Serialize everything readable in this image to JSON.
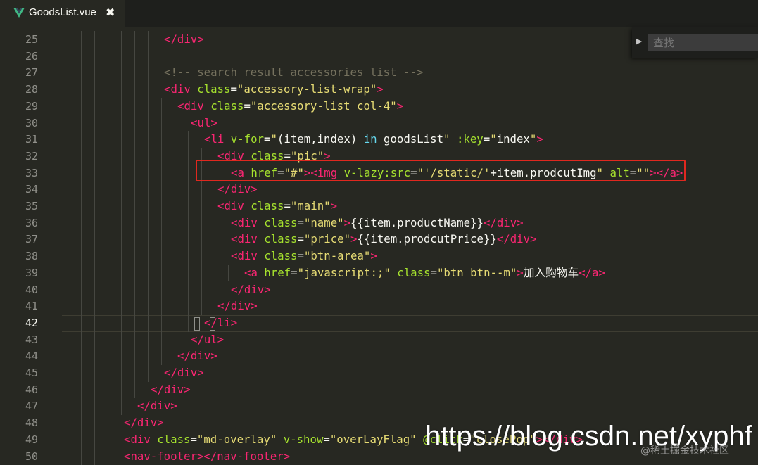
{
  "tab": {
    "title": "GoodsList.vue",
    "close": "✖"
  },
  "find": {
    "placeholder": "查找"
  },
  "current_line": 42,
  "lines": [
    {
      "n": "25",
      "indent": 7,
      "tokens": [
        [
          "tag",
          "</div>"
        ]
      ]
    },
    {
      "n": "26",
      "indent": 0,
      "tokens": []
    },
    {
      "n": "27",
      "indent": 7,
      "tokens": [
        [
          "com",
          "<!-- search result accessories list -->"
        ]
      ]
    },
    {
      "n": "28",
      "indent": 7,
      "tokens": [
        [
          "tag",
          "<div "
        ],
        [
          "attr",
          "class"
        ],
        [
          "pun",
          "="
        ],
        [
          "str",
          "\"accessory-list-wrap\""
        ],
        [
          "tag",
          ">"
        ]
      ]
    },
    {
      "n": "29",
      "indent": 8,
      "tokens": [
        [
          "tag",
          "<div "
        ],
        [
          "attr",
          "class"
        ],
        [
          "pun",
          "="
        ],
        [
          "str",
          "\"accessory-list col-4\""
        ],
        [
          "tag",
          ">"
        ]
      ]
    },
    {
      "n": "30",
      "indent": 9,
      "tokens": [
        [
          "tag",
          "<ul>"
        ]
      ]
    },
    {
      "n": "31",
      "indent": 10,
      "tokens": [
        [
          "tag",
          "<li "
        ],
        [
          "attr",
          "v-for"
        ],
        [
          "pun",
          "="
        ],
        [
          "str",
          "\""
        ],
        [
          "txt",
          "(item,index) "
        ],
        [
          "kw",
          "in"
        ],
        [
          "txt",
          " goodsList"
        ],
        [
          "str",
          "\""
        ],
        [
          "txt",
          " "
        ],
        [
          "attr",
          ":key"
        ],
        [
          "pun",
          "="
        ],
        [
          "str",
          "\""
        ],
        [
          "txt",
          "index"
        ],
        [
          "str",
          "\""
        ],
        [
          "tag",
          ">"
        ]
      ]
    },
    {
      "n": "32",
      "indent": 11,
      "tokens": [
        [
          "tag",
          "<div "
        ],
        [
          "attr",
          "class"
        ],
        [
          "pun",
          "="
        ],
        [
          "str",
          "\"pic\""
        ],
        [
          "tag",
          ">"
        ]
      ]
    },
    {
      "n": "33",
      "indent": 12,
      "tokens": [
        [
          "tag",
          "<a "
        ],
        [
          "attr",
          "href"
        ],
        [
          "pun",
          "="
        ],
        [
          "str",
          "\"#\""
        ],
        [
          "tag",
          ">"
        ],
        [
          "tag",
          "<img "
        ],
        [
          "attr",
          "v-lazy:src"
        ],
        [
          "pun",
          "="
        ],
        [
          "str",
          "\"'/static/'"
        ],
        [
          "txt",
          "+item.prodcutImg"
        ],
        [
          "str",
          "\""
        ],
        [
          "txt",
          " "
        ],
        [
          "attr",
          "alt"
        ],
        [
          "pun",
          "="
        ],
        [
          "str",
          "\"\""
        ],
        [
          "tag",
          ">"
        ],
        [
          "tag",
          "</a>"
        ]
      ]
    },
    {
      "n": "34",
      "indent": 11,
      "tokens": [
        [
          "tag",
          "</div>"
        ]
      ]
    },
    {
      "n": "35",
      "indent": 11,
      "tokens": [
        [
          "tag",
          "<div "
        ],
        [
          "attr",
          "class"
        ],
        [
          "pun",
          "="
        ],
        [
          "str",
          "\"main\""
        ],
        [
          "tag",
          ">"
        ]
      ]
    },
    {
      "n": "36",
      "indent": 12,
      "tokens": [
        [
          "tag",
          "<div "
        ],
        [
          "attr",
          "class"
        ],
        [
          "pun",
          "="
        ],
        [
          "str",
          "\"name\""
        ],
        [
          "tag",
          ">"
        ],
        [
          "txt",
          "{{item.productName}}"
        ],
        [
          "tag",
          "</div>"
        ]
      ]
    },
    {
      "n": "37",
      "indent": 12,
      "tokens": [
        [
          "tag",
          "<div "
        ],
        [
          "attr",
          "class"
        ],
        [
          "pun",
          "="
        ],
        [
          "str",
          "\"price\""
        ],
        [
          "tag",
          ">"
        ],
        [
          "txt",
          "{{item.prodcutPrice}}"
        ],
        [
          "tag",
          "</div>"
        ]
      ]
    },
    {
      "n": "38",
      "indent": 12,
      "tokens": [
        [
          "tag",
          "<div "
        ],
        [
          "attr",
          "class"
        ],
        [
          "pun",
          "="
        ],
        [
          "str",
          "\"btn-area\""
        ],
        [
          "tag",
          ">"
        ]
      ]
    },
    {
      "n": "39",
      "indent": 13,
      "tokens": [
        [
          "tag",
          "<a "
        ],
        [
          "attr",
          "href"
        ],
        [
          "pun",
          "="
        ],
        [
          "str",
          "\"javascript:;\""
        ],
        [
          "txt",
          " "
        ],
        [
          "attr",
          "class"
        ],
        [
          "pun",
          "="
        ],
        [
          "str",
          "\"btn btn--m\""
        ],
        [
          "tag",
          ">"
        ],
        [
          "txt",
          "加入购物车"
        ],
        [
          "tag",
          "</a>"
        ]
      ]
    },
    {
      "n": "40",
      "indent": 12,
      "tokens": [
        [
          "tag",
          "</div>"
        ]
      ]
    },
    {
      "n": "41",
      "indent": 11,
      "tokens": [
        [
          "tag",
          "</div>"
        ]
      ]
    },
    {
      "n": "42",
      "indent": 10,
      "tokens": [
        [
          "tag",
          "</li>"
        ]
      ]
    },
    {
      "n": "43",
      "indent": 9,
      "tokens": [
        [
          "tag",
          "</ul>"
        ]
      ]
    },
    {
      "n": "44",
      "indent": 8,
      "tokens": [
        [
          "tag",
          "</div>"
        ]
      ]
    },
    {
      "n": "45",
      "indent": 7,
      "tokens": [
        [
          "tag",
          "</div>"
        ]
      ]
    },
    {
      "n": "46",
      "indent": 6,
      "tokens": [
        [
          "tag",
          "</div>"
        ]
      ]
    },
    {
      "n": "47",
      "indent": 5,
      "tokens": [
        [
          "tag",
          "</div>"
        ]
      ]
    },
    {
      "n": "48",
      "indent": 4,
      "tokens": [
        [
          "tag",
          "</div>"
        ]
      ]
    },
    {
      "n": "49",
      "indent": 4,
      "tokens": [
        [
          "tag",
          "<div "
        ],
        [
          "attr",
          "class"
        ],
        [
          "pun",
          "="
        ],
        [
          "str",
          "\"md-overlay\""
        ],
        [
          "txt",
          " "
        ],
        [
          "attr",
          "v-show"
        ],
        [
          "pun",
          "="
        ],
        [
          "str",
          "\"overLayFlag\""
        ],
        [
          "txt",
          " "
        ],
        [
          "attr",
          "@click"
        ],
        [
          "pun",
          "="
        ],
        [
          "str",
          "\"closePop\""
        ],
        [
          "tag",
          ">"
        ],
        [
          "tag",
          "</div>"
        ]
      ]
    },
    {
      "n": "50",
      "indent": 4,
      "tokens": [
        [
          "tag",
          "<nav-footer>"
        ],
        [
          "tag",
          "</nav-footer>"
        ]
      ]
    }
  ],
  "watermark": "https://blog.csdn.net/xyphf",
  "watermark_small": "@稀土掘金技术社区",
  "colors": {
    "background": "#272822",
    "tag": "#f92672",
    "attribute": "#a6e22e",
    "string": "#e6db74",
    "comment": "#75715e",
    "keyword": "#66d9ef",
    "highlight_box": "#e0281f",
    "vue_logo": "#41b883"
  }
}
